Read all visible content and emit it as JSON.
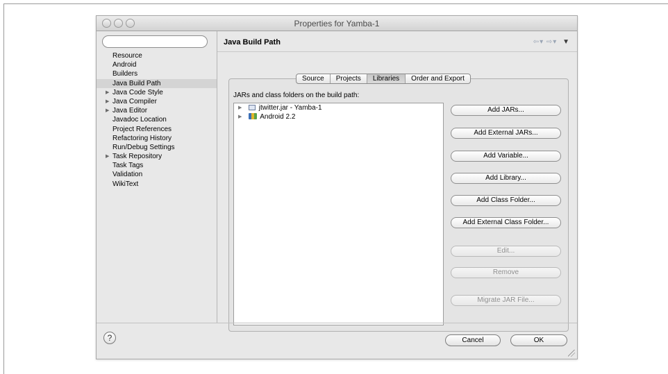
{
  "window": {
    "title": "Properties for Yamba-1"
  },
  "sidebar": {
    "filter_placeholder": "",
    "items": [
      {
        "label": "Resource",
        "expandable": false,
        "selected": false
      },
      {
        "label": "Android",
        "expandable": false,
        "selected": false
      },
      {
        "label": "Builders",
        "expandable": false,
        "selected": false
      },
      {
        "label": "Java Build Path",
        "expandable": false,
        "selected": true
      },
      {
        "label": "Java Code Style",
        "expandable": true,
        "selected": false
      },
      {
        "label": "Java Compiler",
        "expandable": true,
        "selected": false
      },
      {
        "label": "Java Editor",
        "expandable": true,
        "selected": false
      },
      {
        "label": "Javadoc Location",
        "expandable": false,
        "selected": false
      },
      {
        "label": "Project References",
        "expandable": false,
        "selected": false
      },
      {
        "label": "Refactoring History",
        "expandable": false,
        "selected": false
      },
      {
        "label": "Run/Debug Settings",
        "expandable": false,
        "selected": false
      },
      {
        "label": "Task Repository",
        "expandable": true,
        "selected": false
      },
      {
        "label": "Task Tags",
        "expandable": false,
        "selected": false
      },
      {
        "label": "Validation",
        "expandable": false,
        "selected": false
      },
      {
        "label": "WikiText",
        "expandable": false,
        "selected": false
      }
    ]
  },
  "header": {
    "title": "Java Build Path",
    "nav_icons": [
      "back-arrow-icon",
      "forward-arrow-icon",
      "view-menu-icon"
    ]
  },
  "tabs": [
    {
      "label": "Source",
      "active": false
    },
    {
      "label": "Projects",
      "active": false
    },
    {
      "label": "Libraries",
      "active": true
    },
    {
      "label": "Order and Export",
      "active": false
    }
  ],
  "libraries": {
    "caption": "JARs and class folders on the build path:",
    "entries": [
      {
        "label": "jtwitter.jar - Yamba-1",
        "icon": "jar-icon"
      },
      {
        "label": "Android 2.2",
        "icon": "library-icon"
      }
    ]
  },
  "buttons": {
    "add_jars": "Add JARs...",
    "add_external_jars": "Add External JARs...",
    "add_variable": "Add Variable...",
    "add_library": "Add Library...",
    "add_class_folder": "Add Class Folder...",
    "add_external_class_folder": "Add External Class Folder...",
    "edit": "Edit...",
    "remove": "Remove",
    "migrate_jar": "Migrate JAR File..."
  },
  "footer": {
    "help_glyph": "?",
    "cancel": "Cancel",
    "ok": "OK"
  }
}
